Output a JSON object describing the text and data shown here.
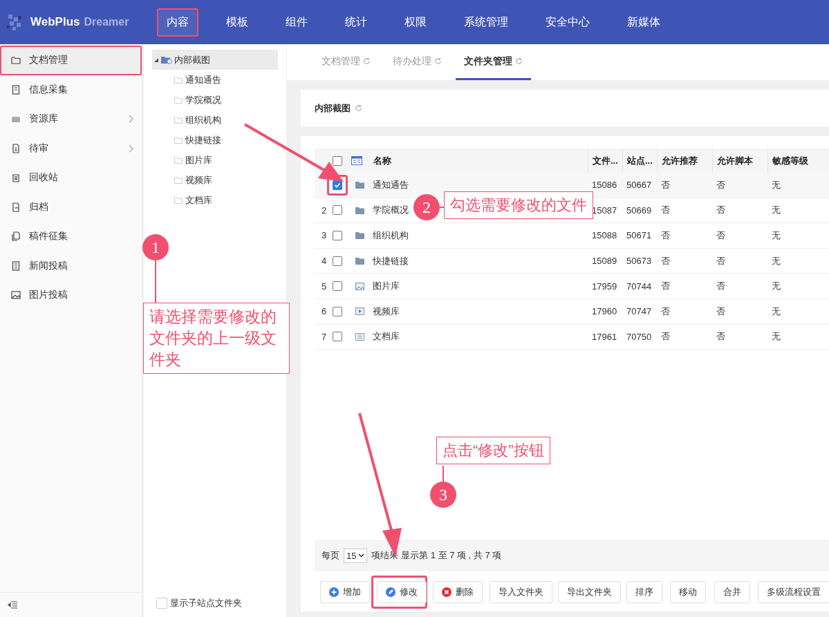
{
  "logo": {
    "brand": "WebPlus",
    "product": "Dreamer"
  },
  "nav": [
    {
      "label": "内容",
      "selected": true,
      "highlighted": true
    },
    {
      "label": "模板",
      "selected": false,
      "highlighted": false
    },
    {
      "label": "组件",
      "selected": false,
      "highlighted": false
    },
    {
      "label": "统计",
      "selected": false,
      "highlighted": false
    },
    {
      "label": "权限",
      "selected": false,
      "highlighted": false
    },
    {
      "label": "系统管理",
      "selected": false,
      "highlighted": false
    },
    {
      "label": "安全中心",
      "selected": false,
      "highlighted": false
    },
    {
      "label": "新媒体",
      "selected": false,
      "highlighted": false
    }
  ],
  "sidebar": {
    "items": [
      {
        "label": "文档管理",
        "kind": "folder",
        "selected": true,
        "highlighted": true,
        "has_submenu": false
      },
      {
        "label": "信息采集",
        "kind": "clipboard",
        "selected": false,
        "highlighted": false,
        "has_submenu": false
      },
      {
        "label": "资源库",
        "kind": "box",
        "selected": false,
        "highlighted": false,
        "has_submenu": true
      },
      {
        "label": "待审",
        "kind": "stamp",
        "selected": false,
        "highlighted": false,
        "has_submenu": true
      },
      {
        "label": "回收站",
        "kind": "trash",
        "selected": false,
        "highlighted": false,
        "has_submenu": false
      },
      {
        "label": "归档",
        "kind": "archive",
        "selected": false,
        "highlighted": false,
        "has_submenu": false
      },
      {
        "label": "稿件征集",
        "kind": "docs",
        "selected": false,
        "highlighted": false,
        "has_submenu": false
      },
      {
        "label": "新闻投稿",
        "kind": "news",
        "selected": false,
        "highlighted": false,
        "has_submenu": false
      },
      {
        "label": "图片投稿",
        "kind": "image",
        "selected": false,
        "highlighted": false,
        "has_submenu": false
      }
    ]
  },
  "tree": {
    "root": {
      "label": "内部截图",
      "expanded": true,
      "selected": true,
      "children": [
        {
          "label": "通知通告"
        },
        {
          "label": "学院概况"
        },
        {
          "label": "组织机构"
        },
        {
          "label": "快捷链接"
        },
        {
          "label": "图片库"
        },
        {
          "label": "视频库"
        },
        {
          "label": "文档库"
        }
      ]
    },
    "show_subsite": {
      "label": "显示子站点文件夹",
      "checked": false
    }
  },
  "tabs": [
    {
      "label": "文档管理",
      "selected": false
    },
    {
      "label": "待办处理",
      "selected": false
    },
    {
      "label": "文件夹管理",
      "selected": true
    }
  ],
  "breadcrumb": "内部截图",
  "table": {
    "header_checked": false,
    "columns": [
      "名称",
      "文件...",
      "站点...",
      "允许推荐",
      "允许脚本",
      "敏感等级"
    ],
    "rows": [
      {
        "number": "",
        "kind": "folder",
        "checked": true,
        "highlighted": true,
        "cells": [
          "通知通告",
          "15086",
          "50667",
          "否",
          "否",
          "无"
        ]
      },
      {
        "number": "2",
        "kind": "folder",
        "checked": false,
        "highlighted": false,
        "cells": [
          "学院概况",
          "15087",
          "50669",
          "否",
          "否",
          "无"
        ]
      },
      {
        "number": "3",
        "kind": "folder",
        "checked": false,
        "highlighted": false,
        "cells": [
          "组织机构",
          "15088",
          "50671",
          "否",
          "否",
          "无"
        ]
      },
      {
        "number": "4",
        "kind": "folder",
        "checked": false,
        "highlighted": false,
        "cells": [
          "快捷链接",
          "15089",
          "50673",
          "否",
          "否",
          "无"
        ]
      },
      {
        "number": "5",
        "kind": "image",
        "checked": false,
        "highlighted": false,
        "cells": [
          "图片库",
          "17959",
          "70744",
          "否",
          "否",
          "无"
        ]
      },
      {
        "number": "6",
        "kind": "video",
        "checked": false,
        "highlighted": false,
        "cells": [
          "视频库",
          "17960",
          "70747",
          "否",
          "否",
          "无"
        ]
      },
      {
        "number": "7",
        "kind": "document",
        "checked": false,
        "highlighted": false,
        "cells": [
          "文档库",
          "17961",
          "70750",
          "否",
          "否",
          "无"
        ]
      }
    ]
  },
  "pager": {
    "per_page_label": "每页",
    "per_page": "15",
    "summary": "项结果 显示第 1 至 7 项 , 共 7 项"
  },
  "buttons": [
    {
      "label": "增加",
      "kind": "add",
      "highlighted": false
    },
    {
      "label": "修改",
      "kind": "edit",
      "highlighted": true
    },
    {
      "label": "删除",
      "kind": "delete",
      "highlighted": false
    },
    {
      "label": "导入文件夹",
      "kind": "plain",
      "highlighted": false
    },
    {
      "label": "导出文件夹",
      "kind": "plain",
      "highlighted": false
    },
    {
      "label": "排序",
      "kind": "plain",
      "highlighted": false
    },
    {
      "label": "移动",
      "kind": "plain",
      "highlighted": false
    },
    {
      "label": "合并",
      "kind": "plain",
      "highlighted": false
    },
    {
      "label": "多级流程设置",
      "kind": "plain",
      "highlighted": false
    }
  ],
  "callouts": [
    {
      "number": "1",
      "text": "请选择需要修改的文件夹的上一级文件夹"
    },
    {
      "number": "2",
      "text": "勾选需要修改的文件"
    },
    {
      "number": "3",
      "text": "点击“修改”按钮"
    }
  ]
}
